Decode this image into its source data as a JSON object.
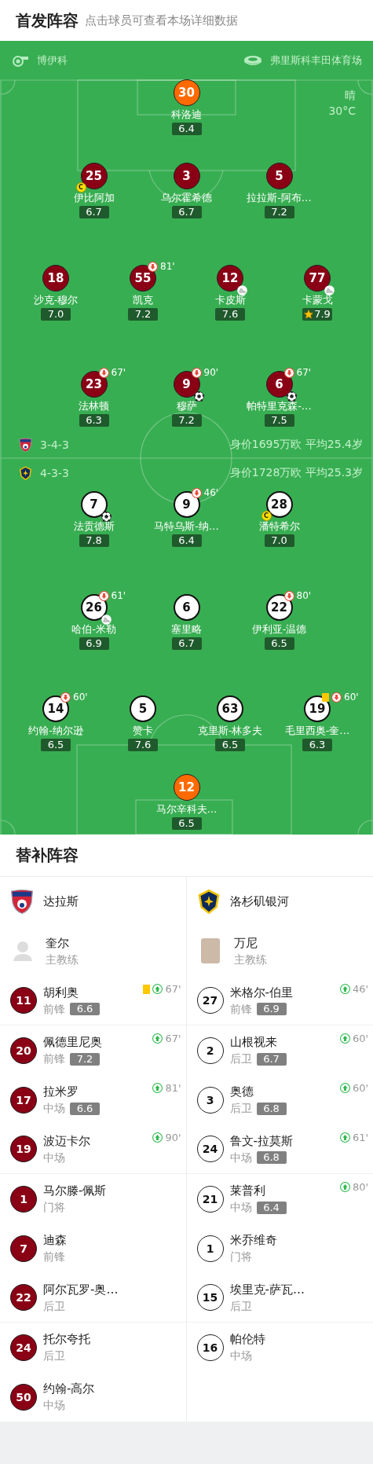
{
  "header": {
    "title": "首发阵容",
    "subtitle": "点击球员可查看本场详细数据"
  },
  "match_info": {
    "referee": "博伊科",
    "stadium": "弗里斯科丰田体育场",
    "weather": "晴",
    "temperature": "30°C"
  },
  "home": {
    "kind": "home",
    "formation": "3-4-3",
    "value_info": "身价1695万欧 平均25.4岁",
    "rows": [
      {
        "kind": "goalkeeper",
        "players": [
          {
            "number": "30",
            "name": "科洛迪",
            "rating": "6.4"
          }
        ]
      },
      {
        "kind": "outfield",
        "players": [
          {
            "number": "25",
            "name": "伊比阿加",
            "rating": "6.7",
            "badges": [
              {
                "kind": "captain",
                "label": "C"
              }
            ]
          },
          {
            "number": "3",
            "name": "乌尔霍希德",
            "rating": "6.7"
          },
          {
            "number": "5",
            "name": "拉拉斯-阿布…",
            "rating": "7.2"
          }
        ]
      },
      {
        "kind": "outfield",
        "players": [
          {
            "number": "18",
            "name": "沙克-穆尔",
            "rating": "7.0"
          },
          {
            "number": "55",
            "name": "凯克",
            "rating": "7.2",
            "sub_off": "81'"
          },
          {
            "number": "12",
            "name": "卡皮斯",
            "rating": "7.6",
            "badges": [
              {
                "kind": "assist"
              }
            ]
          },
          {
            "number": "77",
            "name": "卡蒙戈",
            "rating": "7.9",
            "badges": [
              {
                "kind": "assist"
              },
              {
                "kind": "best"
              }
            ]
          }
        ]
      },
      {
        "kind": "outfield",
        "players": [
          {
            "number": "23",
            "name": "法林顿",
            "rating": "6.3",
            "sub_off": "67'"
          },
          {
            "number": "9",
            "name": "穆萨",
            "rating": "7.2",
            "sub_off": "90'",
            "badges": [
              {
                "kind": "goal"
              }
            ]
          },
          {
            "number": "6",
            "name": "帕特里克森-…",
            "rating": "7.5",
            "sub_off": "67'",
            "badges": [
              {
                "kind": "goal"
              }
            ]
          }
        ]
      }
    ]
  },
  "away": {
    "kind": "away",
    "formation": "4-3-3",
    "value_info": "身价1728万欧 平均25.3岁",
    "rows": [
      {
        "kind": "outfield",
        "players": [
          {
            "number": "7",
            "name": "法贡德斯",
            "rating": "7.8",
            "badges": [
              {
                "kind": "goal"
              }
            ]
          },
          {
            "number": "9",
            "name": "马特乌斯-纳…",
            "rating": "6.4",
            "sub_off": "46'"
          },
          {
            "number": "28",
            "name": "潘特希尔",
            "rating": "7.0",
            "badges": [
              {
                "kind": "captain",
                "label": "C"
              }
            ]
          }
        ]
      },
      {
        "kind": "outfield",
        "players": [
          {
            "number": "26",
            "name": "哈伯-米勒",
            "rating": "6.9",
            "sub_off": "61'",
            "badges": [
              {
                "kind": "assist"
              }
            ]
          },
          {
            "number": "6",
            "name": "塞里略",
            "rating": "6.7"
          },
          {
            "number": "22",
            "name": "伊利亚-温德",
            "rating": "6.5",
            "sub_off": "80'"
          }
        ]
      },
      {
        "kind": "outfield",
        "players": [
          {
            "number": "14",
            "name": "约翰-纳尔逊",
            "rating": "6.5",
            "sub_off": "60'"
          },
          {
            "number": "5",
            "name": "赞卡",
            "rating": "7.6"
          },
          {
            "number": "63",
            "name": "克里斯-林多夫",
            "rating": "6.5"
          },
          {
            "number": "19",
            "name": "毛里西奥-奎…",
            "rating": "6.3",
            "sub_off": "60'",
            "badges": [
              {
                "kind": "yellow_card"
              }
            ]
          }
        ]
      },
      {
        "kind": "goalkeeper",
        "players": [
          {
            "number": "12",
            "name": "马尔辛科夫…",
            "rating": "6.5"
          }
        ]
      }
    ]
  },
  "substitutes": {
    "title": "替补阵容",
    "teams": [
      {
        "kind": "home",
        "name": "达拉斯",
        "coach": {
          "name": "奎尔",
          "role": "主教练"
        },
        "players": [
          {
            "number": "11",
            "name": "胡利奥",
            "position": "前锋",
            "rating": "6.6",
            "sub_on": "67'",
            "yellow_card": true
          },
          {
            "number": "20",
            "name": "佩德里尼奥",
            "position": "前锋",
            "rating": "7.2",
            "sub_on": "67'",
            "yellow_card": false
          },
          {
            "number": "17",
            "name": "拉米罗",
            "position": "中场",
            "rating": "6.6",
            "sub_on": "81'",
            "yellow_card": false
          },
          {
            "number": "19",
            "name": "波迈卡尔",
            "position": "中场",
            "sub_on": "90'",
            "yellow_card": false
          },
          {
            "number": "1",
            "name": "马尔滕-佩斯",
            "position": "门将",
            "yellow_card": false
          },
          {
            "number": "7",
            "name": "迪森",
            "position": "前锋",
            "yellow_card": false
          },
          {
            "number": "22",
            "name": "阿尔瓦罗-奥…",
            "position": "后卫",
            "yellow_card": false
          },
          {
            "number": "24",
            "name": "托尔夸托",
            "position": "后卫",
            "yellow_card": false
          },
          {
            "number": "50",
            "name": "约翰-高尔",
            "position": "中场",
            "yellow_card": false
          }
        ]
      },
      {
        "kind": "away",
        "name": "洛杉矶银河",
        "coach": {
          "name": "万尼",
          "role": "主教练"
        },
        "players": [
          {
            "number": "27",
            "name": "米格尔-伯里",
            "position": "前锋",
            "rating": "6.9",
            "sub_on": "46'",
            "yellow_card": false
          },
          {
            "number": "2",
            "name": "山根视来",
            "position": "后卫",
            "rating": "6.7",
            "sub_on": "60'",
            "yellow_card": false
          },
          {
            "number": "3",
            "name": "奥德",
            "position": "后卫",
            "rating": "6.8",
            "sub_on": "60'",
            "yellow_card": false
          },
          {
            "number": "24",
            "name": "鲁文-拉莫斯",
            "position": "中场",
            "rating": "6.8",
            "sub_on": "61'",
            "yellow_card": false
          },
          {
            "number": "21",
            "name": "莱普利",
            "position": "中场",
            "rating": "6.4",
            "sub_on": "80'",
            "yellow_card": false
          },
          {
            "number": "1",
            "name": "米乔维奇",
            "position": "门将",
            "yellow_card": false
          },
          {
            "number": "15",
            "name": "埃里克-萨瓦…",
            "position": "后卫",
            "yellow_card": false
          },
          {
            "number": "16",
            "name": "帕伦特",
            "position": "中场",
            "yellow_card": false
          }
        ]
      }
    ]
  }
}
